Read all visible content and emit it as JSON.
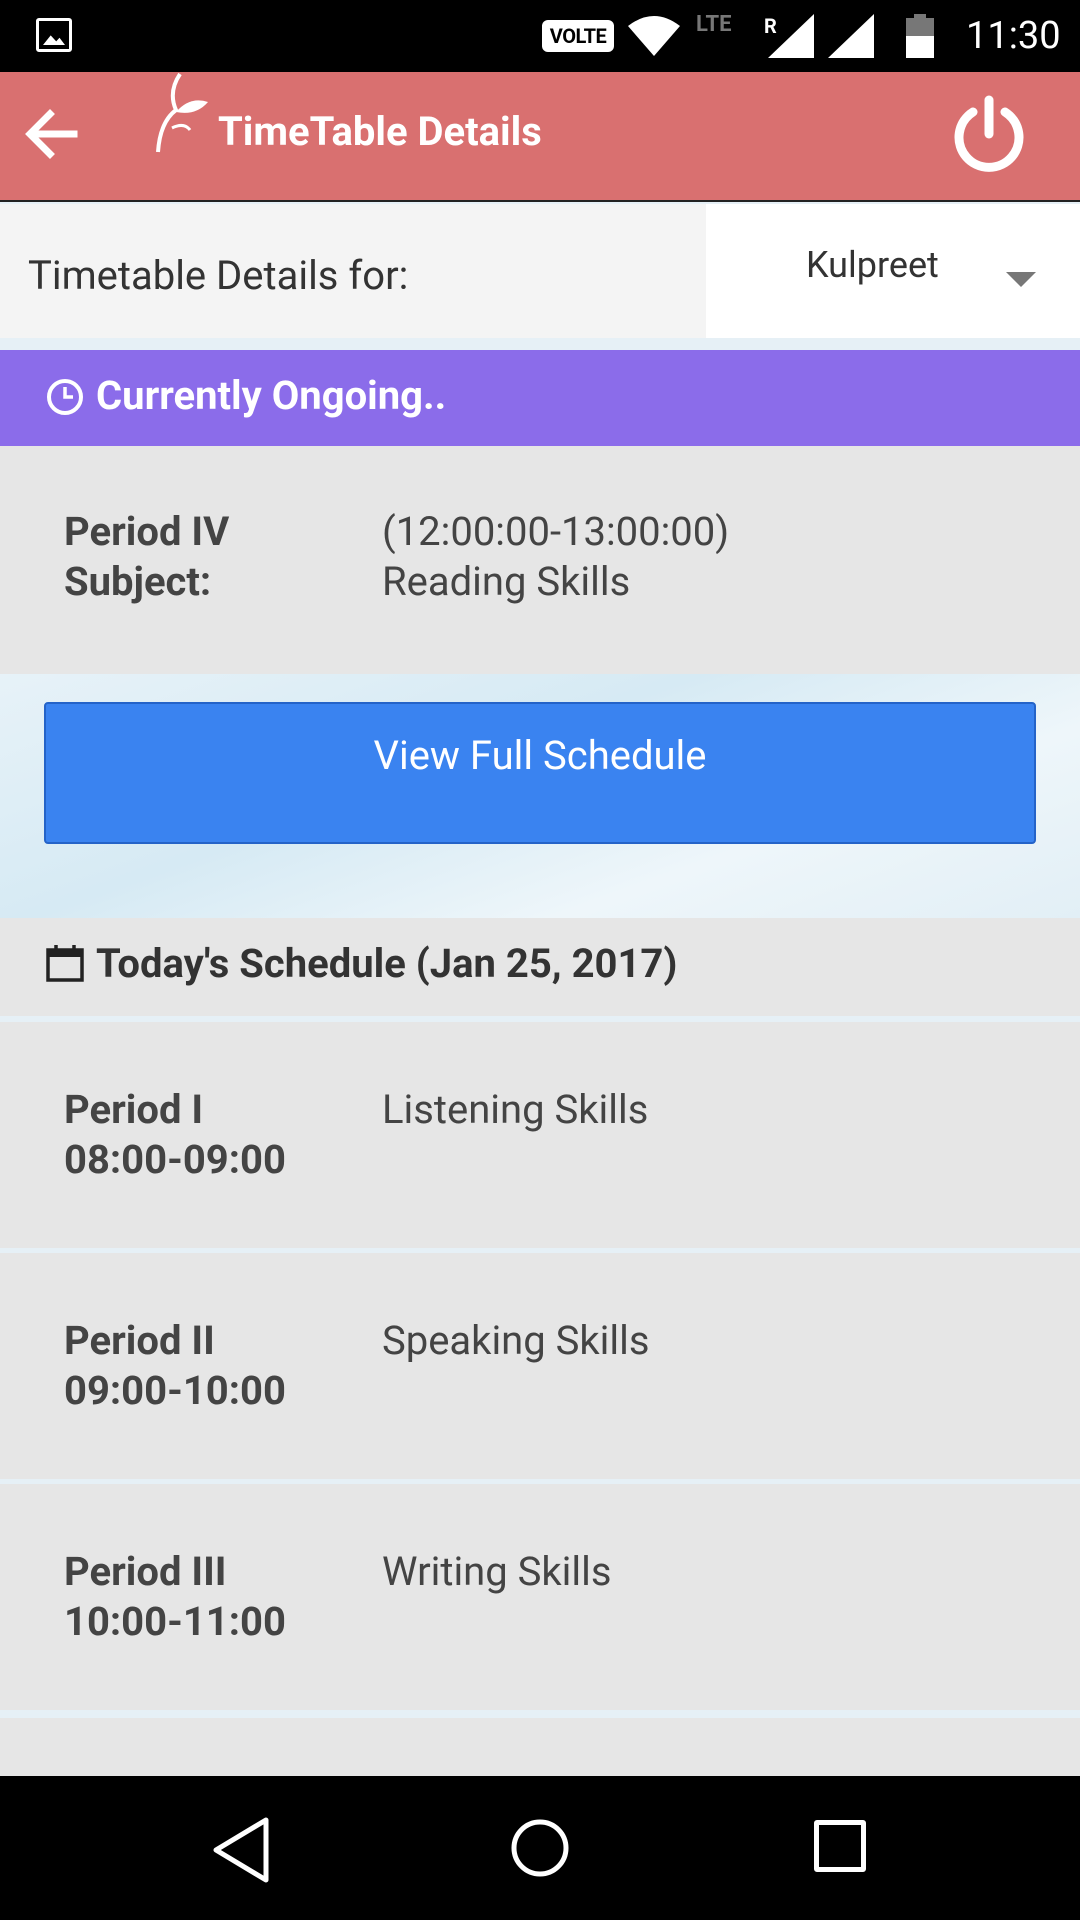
{
  "status_bar": {
    "volte_label": "VOLTE",
    "network_label": "LTE",
    "roaming_label": "R",
    "time": "11:30"
  },
  "app_bar": {
    "title": "TimeTable Details"
  },
  "selector": {
    "label": "Timetable Details for:",
    "selected_student": "Kulpreet"
  },
  "ongoing": {
    "header": "Currently Ongoing..",
    "period_label": "Period IV",
    "period_time": "(12:00:00-13:00:00)",
    "subject_label": "Subject:",
    "subject_value": "Reading Skills"
  },
  "actions": {
    "view_full_schedule": "View Full Schedule"
  },
  "today": {
    "header": "Today's Schedule (Jan 25, 2017)",
    "rows": [
      {
        "period": "Period I",
        "time": "08:00-09:00",
        "subject": "Listening Skills"
      },
      {
        "period": "Period II",
        "time": "09:00-10:00",
        "subject": "Speaking Skills"
      },
      {
        "period": "Period III",
        "time": "10:00-11:00",
        "subject": "Writing Skills"
      }
    ]
  },
  "colors": {
    "app_bar": "#d97070",
    "ongoing_header": "#8b6cea",
    "primary_button": "#3a83f0"
  },
  "icons": {
    "back": "arrow-left-icon",
    "logo": "leaf-logo-icon",
    "power": "power-icon",
    "clock": "clock-icon",
    "calendar": "calendar-icon",
    "dropdown": "caret-down-icon"
  }
}
